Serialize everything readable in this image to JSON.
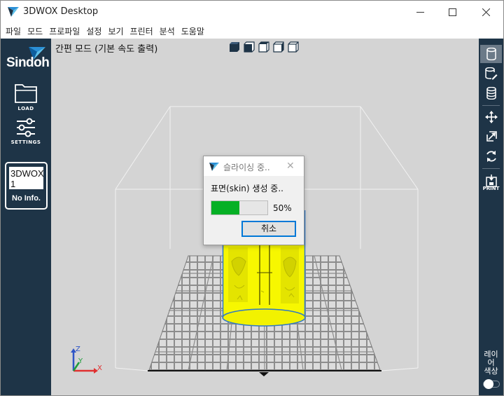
{
  "window": {
    "title": "3DWOX Desktop",
    "controls": [
      "minimize-icon",
      "maximize-icon",
      "close-icon"
    ]
  },
  "menu": [
    "파일",
    "모드",
    "프로파일",
    "설정",
    "보기",
    "프린터",
    "분석",
    "도움말"
  ],
  "left_sidebar": {
    "brand": "Sindoh",
    "load_label": "LOAD",
    "settings_label": "SETTINGS",
    "printer_model": "3DWOX\n1",
    "printer_status": "No Info."
  },
  "viewport": {
    "mode_title": "간편 모드 (기본 속도 출력)",
    "view_buttons": [
      "view-iso-icon",
      "view-front-icon",
      "view-top-icon",
      "view-left-icon",
      "view-right-icon"
    ],
    "axes": {
      "z": "Z",
      "y": "Y",
      "x": "X"
    },
    "model_color": "#ffff00",
    "plate_color": "#8a8a8a"
  },
  "right_sidebar": {
    "print_label": "PRINT",
    "layer_color_label": "레이\n어\n색상",
    "tools": [
      "database-icon",
      "database-edit-icon",
      "database-stack-icon",
      "move-icon",
      "scale-icon",
      "rotate-icon",
      "print-icon"
    ]
  },
  "dialog": {
    "title": "슬라이싱 중..",
    "status": "표면(skin) 생성 중..",
    "progress": 0.5,
    "progress_text": "50%",
    "cancel_label": "취소",
    "progress_color": "#06b025"
  },
  "colors": {
    "sidebar": "#1e3447",
    "viewport_bg": "#d4d4d4",
    "accent": "#0078d7"
  }
}
